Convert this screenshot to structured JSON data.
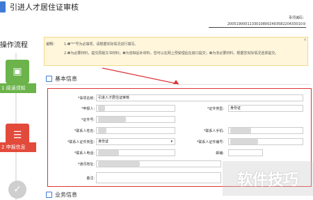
{
  "window": {
    "title": "引进人才居住证审核"
  },
  "header": {
    "code_label": "事项编码：",
    "code_value": "2005190001133010800249358220433010８"
  },
  "sidebar": {
    "title": "操作流程",
    "steps": [
      {
        "label": "1 阅读须知",
        "icon": "book-icon"
      },
      {
        "label": "2 申报信息",
        "icon": "form-icon"
      },
      {
        "label": "",
        "icon": "check-icon"
      }
    ]
  },
  "notice": {
    "label": "说明：",
    "line1": "1.❶\"*\"号为必填项，请根据实际情况进行填写。",
    "line2": "2.❷为必要材料，提交原版文书材料；❸为容缺后补材料，您可以在网上预受理后在窗口提交；❹为非必要材料，根据您实际情况选择提交。"
  },
  "section_basic": {
    "title": "基本信息"
  },
  "section_business": {
    "title": "业务信息"
  },
  "form": {
    "item_name_label": "*事项名称:",
    "item_name_value": "引进人才居住证审核",
    "applicant_label": "*申报人:",
    "id_type_label": "*证件类型:",
    "id_type_value": "身份证",
    "id_number_label": "*证件号:",
    "contact_name_label": "*联系人姓名:",
    "contact_phone_label": "*联系人手机:",
    "contact_id_type_label": "*联系人证件类型:",
    "contact_id_type_value": "身份证",
    "contact_id_number_label": "*联系人证件编号:",
    "contact_tel_label": "*联系人电话:",
    "email_label": "邮编:",
    "address_label": "*通讯地址:",
    "remark_label": "备注:"
  },
  "watermark": "软件技巧",
  "colors": {
    "accent": "#3f7bd6",
    "step_done": "#6bb34a",
    "step_active": "#e24a3b",
    "highlight": "#dd3333"
  }
}
